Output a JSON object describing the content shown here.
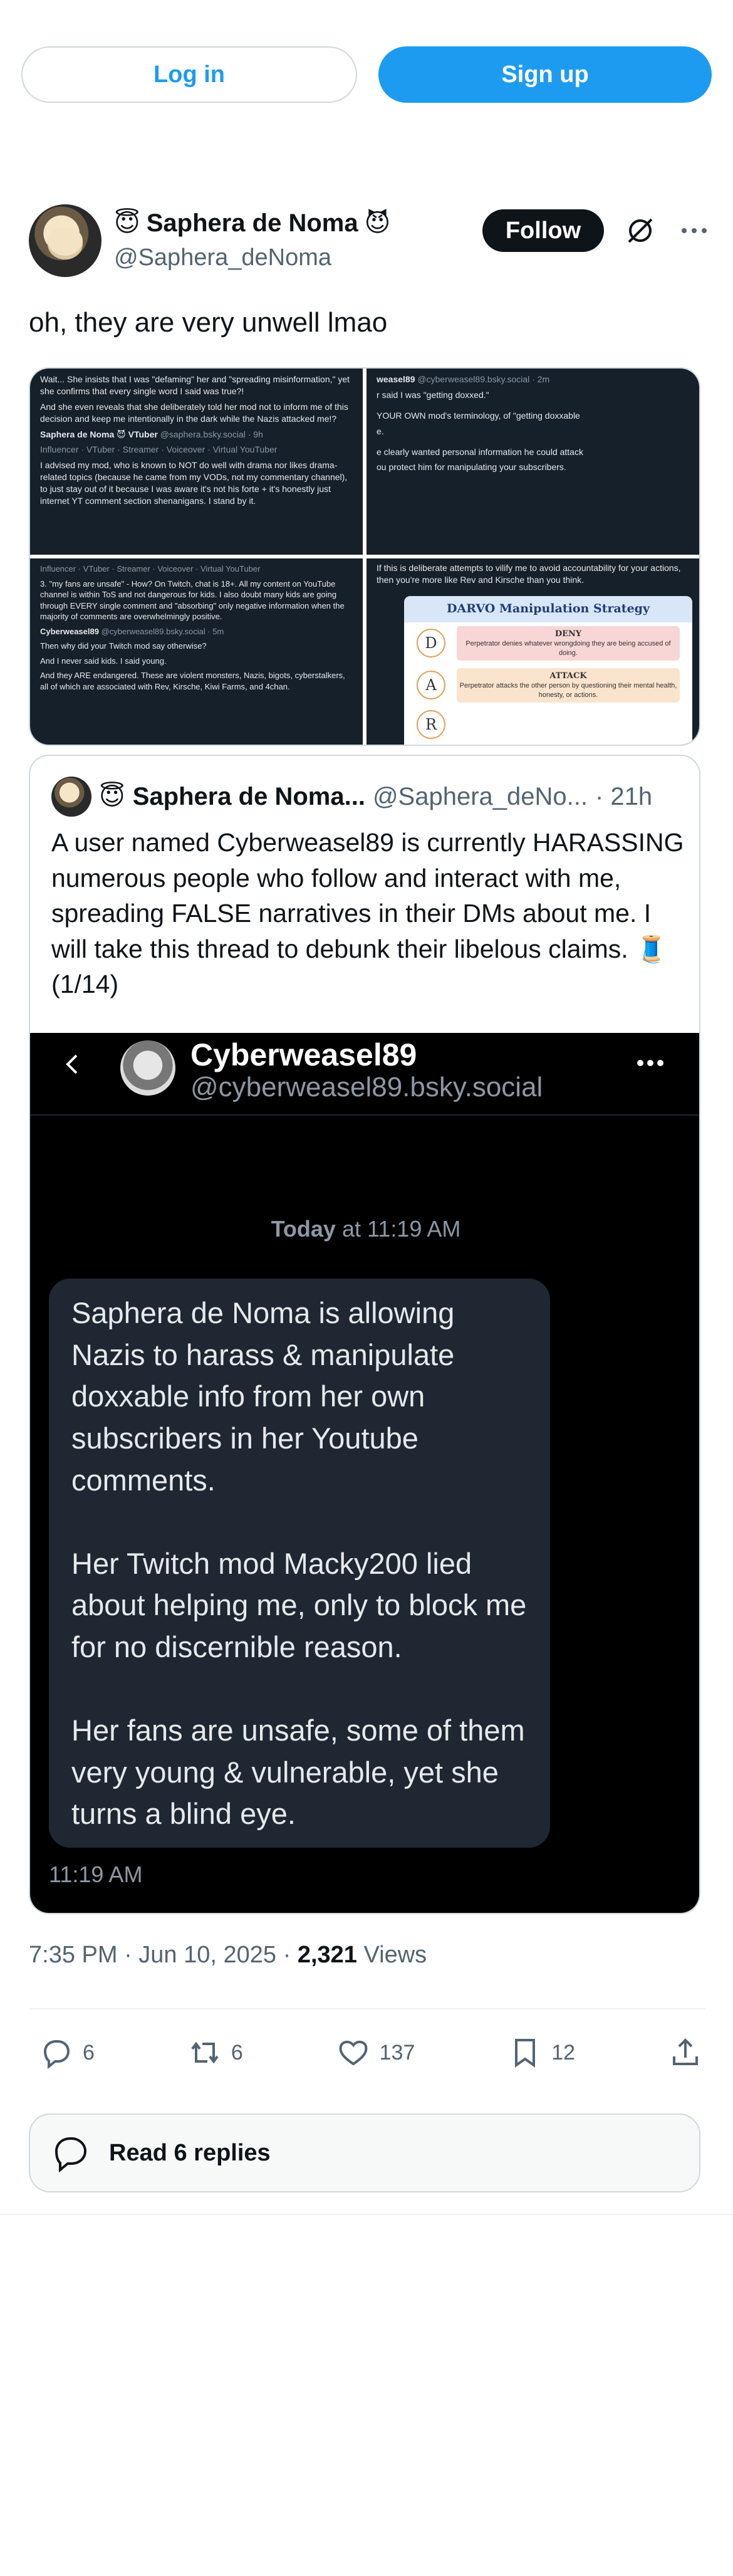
{
  "auth": {
    "login": "Log in",
    "signup": "Sign up"
  },
  "author": {
    "name": "Saphera de Noma",
    "prefix_emoji": "😇",
    "suffix_emoji": "😈",
    "handle": "@Saphera_deNoma",
    "follow": "Follow"
  },
  "tweet": {
    "text": "oh, they are very unwell lmao"
  },
  "media": {
    "tile1": {
      "p1": "Wait... She insists that I was \"defaming\" her and \"spreading misinformation,\" yet she confirms that every single word I said was true?!",
      "p2": "And she even reveals that she deliberately told her mod not to inform me of this decision and keep me intentionally in the dark while the Nazis attacked me!?",
      "quoted_name": "Saphera de Noma 😈 VTuber",
      "quoted_handle": "@saphera.bsky.social · 9h",
      "quoted_tags": "Influencer · VTuber · Streamer · Voiceover · Virtual YouTuber",
      "p3": "I advised my mod, who is known to NOT do well with drama nor likes drama-related topics (because he came from my VODs, not my commentary channel), to just stay out of it because I was aware it's not his forte + it's honestly just internet YT comment section shenanigans. I stand by it."
    },
    "tile2": {
      "line1_name": "weasel89",
      "line1_handle": "@cyberweasel89.bsky.social · 2m",
      "line2": "r said I was \"getting doxxed.\"",
      "line3": "YOUR OWN mod's terminology, of \"getting doxxable",
      "line4": "e.",
      "line5": "e clearly wanted personal information he could attack",
      "line6": "ou protect him for manipulating your subscribers."
    },
    "tile3": {
      "tags": "Influencer · VTuber · Streamer · Voiceover · Virtual YouTuber",
      "p1": "3. \"my fans are unsafe\" - How? On Twitch, chat is 18+. All my content on YouTube channel is within ToS and not dangerous for kids. I also doubt many kids are going through EVERY single comment and \"absorbing\" only negative information when the majority of comments are overwhelmingly positive.",
      "reply_name": "Cyberweasel89",
      "reply_handle": "@cyberweasel89.bsky.social · 5m",
      "p2": "Then why did your Twitch mod say otherwise?",
      "p3": "And I never said kids. I said young.",
      "p4": "And they ARE endangered. These are violent monsters, Nazis, bigots, cyberstalkers, all of which are associated with Rev, Kirsche, Kiwi Farms, and 4chan."
    },
    "tile4": {
      "caption": "If this is deliberate attempts to vilify me to avoid accountability for your actions, then you're more like Rev and Kirsche than you think.",
      "darvo_title": "DARVO Manipulation Strategy",
      "rows": [
        {
          "letter": "D",
          "title": "DENY",
          "desc": "Perpetrator denies whatever wrongdoing they are being accused of doing."
        },
        {
          "letter": "A",
          "title": "ATTACK",
          "desc": "Perpetrator attacks the other person by questioning their mental health, honesty, or actions."
        },
        {
          "letter": "R",
          "title": "",
          "desc": ""
        }
      ]
    }
  },
  "quote": {
    "name": "Saphera de Noma...",
    "prefix_emoji": "😇",
    "handle": "@Saphera_deNo...",
    "time": "· 21h",
    "text": "A user named Cyberweasel89 is currently HARASSING numerous people who follow and interact with me, spreading FALSE narratives in their DMs about me.  I will take this thread to debunk their libelous claims. 🧵 (1/14)",
    "dm": {
      "name": "Cyberweasel89",
      "handle": "@cyberweasel89.bsky.social",
      "date_bold": "Today",
      "date_rest": " at 11:19 AM",
      "p1": "Saphera de Noma is allowing Nazis to harass & manipulate doxxable info from her own subscribers in her Youtube comments.",
      "p2": "Her Twitch mod Macky200 lied about helping me, only to block me for no discernible reason.",
      "p3": "Her fans are unsafe, some of them very young & vulnerable, yet she turns a blind eye.",
      "time": "11:19 AM"
    }
  },
  "meta": {
    "datetime": "7:35 PM · Jun 10, 2025 · ",
    "views_count": "2,321",
    "views_label": " Views"
  },
  "actions": {
    "replies": "6",
    "reposts": "6",
    "likes": "137",
    "bookmarks": "12"
  },
  "read_replies": "Read 6 replies",
  "colors": {
    "accent": "#1d9bf0",
    "text": "#0f1419",
    "muted": "#536471"
  }
}
